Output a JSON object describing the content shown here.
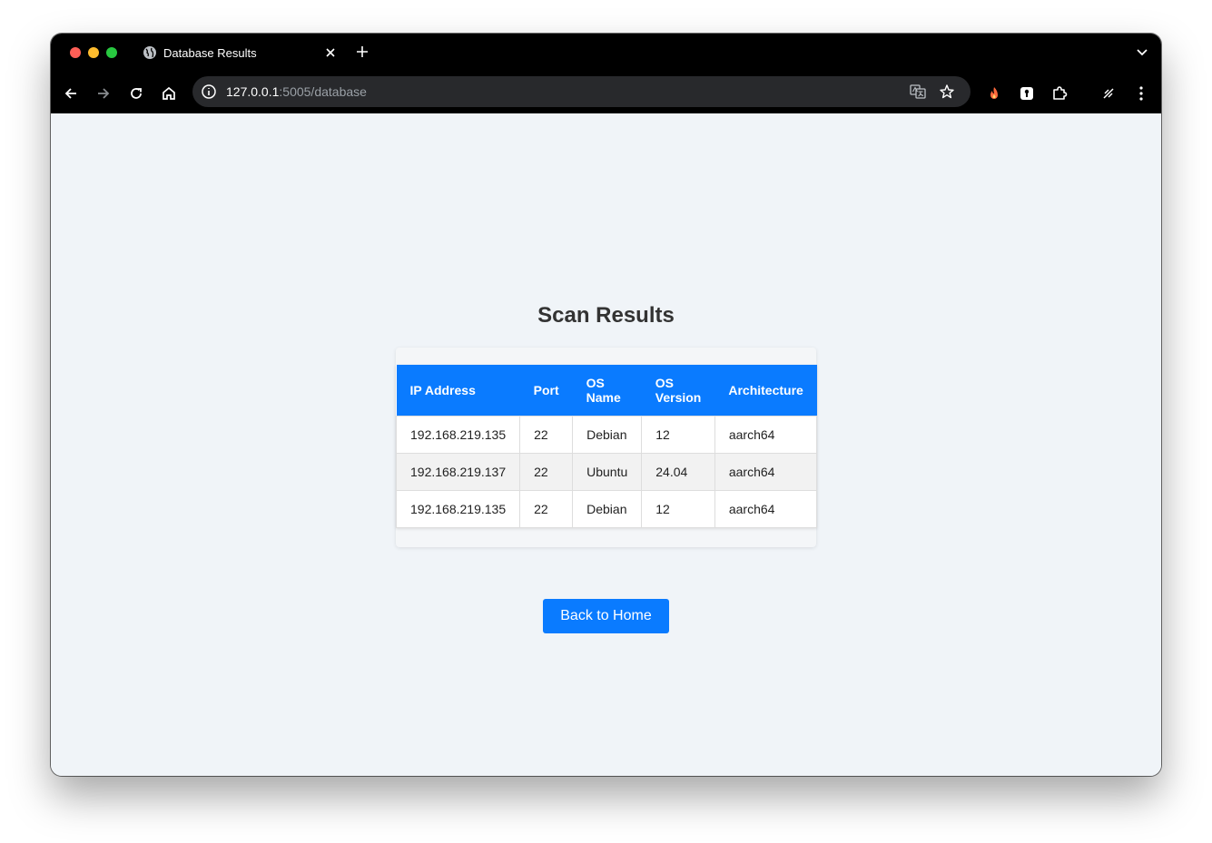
{
  "browser": {
    "tab_title": "Database Results",
    "url_host": "127.0.0.1",
    "url_rest": ":5005/database"
  },
  "page": {
    "title": "Scan Results",
    "table": {
      "headers": [
        "IP Address",
        "Port",
        "OS Name",
        "OS Version",
        "Architecture"
      ],
      "rows": [
        [
          "192.168.219.135",
          "22",
          "Debian",
          "12",
          "aarch64"
        ],
        [
          "192.168.219.137",
          "22",
          "Ubuntu",
          "24.04",
          "aarch64"
        ],
        [
          "192.168.219.135",
          "22",
          "Debian",
          "12",
          "aarch64"
        ]
      ]
    },
    "back_button_label": "Back to Home"
  },
  "colors": {
    "accent": "#0a7bff",
    "page_background": "#f0f4f8",
    "title_text": "#333333"
  }
}
